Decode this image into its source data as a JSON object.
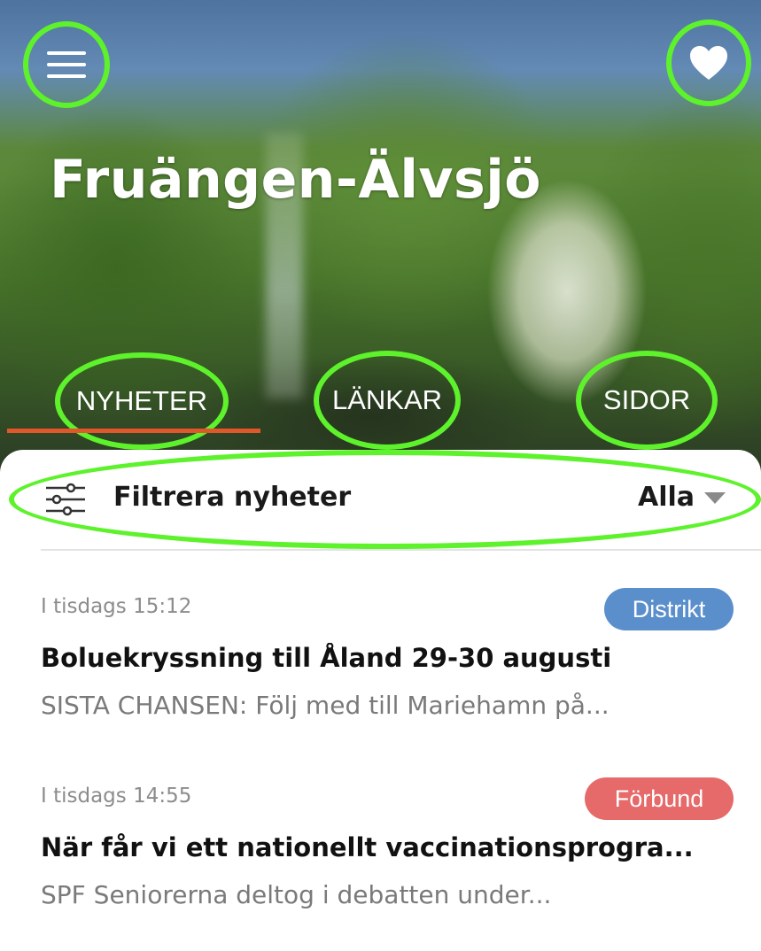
{
  "header": {
    "title": "Fruängen-Älvsjö",
    "menu_icon": "hamburger-menu-icon",
    "favorite_icon": "heart-icon"
  },
  "tabs": [
    {
      "label": "NYHETER",
      "selected": true
    },
    {
      "label": "LÄNKAR",
      "selected": false
    },
    {
      "label": "SIDOR",
      "selected": false
    }
  ],
  "filter": {
    "icon": "sliders-icon",
    "label": "Filtrera nyheter",
    "value": "Alla",
    "caret_icon": "caret-down-icon"
  },
  "news": [
    {
      "time": "I tisdags 15:12",
      "badge": "Distrikt",
      "badge_color": "#5b8fcc",
      "title": "Boluekryssning till Åland 29-30 augusti",
      "summary": "SISTA CHANSEN: Följ med till Mariehamn på..."
    },
    {
      "time": "I tisdags 14:55",
      "badge": "Förbund",
      "badge_color": "#e66a6a",
      "title": "När får vi ett nationellt vaccinationsprogra...",
      "summary": "SPF Seniorerna deltog i debatten under..."
    }
  ],
  "colors": {
    "highlight_ring": "#5df22b",
    "tab_indicator": "#e2572a",
    "text_primary": "#111111",
    "text_muted": "#8c8c8c"
  }
}
